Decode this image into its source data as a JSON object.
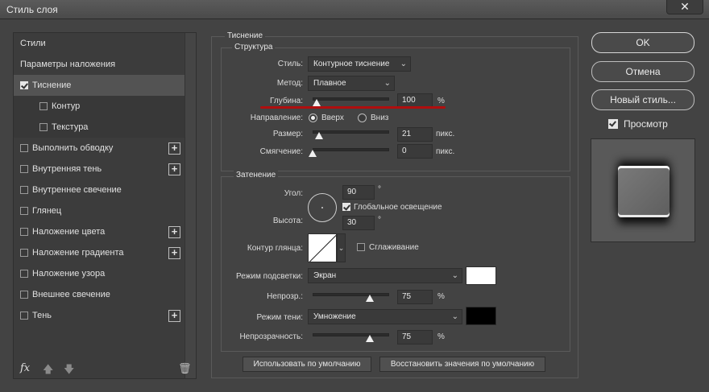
{
  "window": {
    "title": "Стиль слоя",
    "close": "✕"
  },
  "left": {
    "items": [
      {
        "label": "Стили",
        "checkbox": false,
        "plus": false,
        "sub": false,
        "selected": false
      },
      {
        "label": "Параметры наложения",
        "checkbox": false,
        "plus": false,
        "sub": false,
        "selected": false
      },
      {
        "label": "Тиснение",
        "checkbox": true,
        "checked": true,
        "plus": false,
        "sub": false,
        "selected": true
      },
      {
        "label": "Контур",
        "checkbox": true,
        "checked": false,
        "plus": false,
        "sub": true,
        "selected": false
      },
      {
        "label": "Текстура",
        "checkbox": true,
        "checked": false,
        "plus": false,
        "sub": true,
        "selected": false
      },
      {
        "label": "Выполнить обводку",
        "checkbox": true,
        "checked": false,
        "plus": true,
        "sub": false,
        "selected": false
      },
      {
        "label": "Внутренняя тень",
        "checkbox": true,
        "checked": false,
        "plus": true,
        "sub": false,
        "selected": false
      },
      {
        "label": "Внутреннее свечение",
        "checkbox": true,
        "checked": false,
        "plus": false,
        "sub": false,
        "selected": false
      },
      {
        "label": "Глянец",
        "checkbox": true,
        "checked": false,
        "plus": false,
        "sub": false,
        "selected": false
      },
      {
        "label": "Наложение цвета",
        "checkbox": true,
        "checked": false,
        "plus": true,
        "sub": false,
        "selected": false
      },
      {
        "label": "Наложение градиента",
        "checkbox": true,
        "checked": false,
        "plus": true,
        "sub": false,
        "selected": false
      },
      {
        "label": "Наложение узора",
        "checkbox": true,
        "checked": false,
        "plus": false,
        "sub": false,
        "selected": false
      },
      {
        "label": "Внешнее свечение",
        "checkbox": true,
        "checked": false,
        "plus": false,
        "sub": false,
        "selected": false
      },
      {
        "label": "Тень",
        "checkbox": true,
        "checked": false,
        "plus": true,
        "sub": false,
        "selected": false
      }
    ],
    "toolbar": {
      "fx": "fx",
      "up": "🡅",
      "down": "🡇",
      "trash": "🗑"
    }
  },
  "bevel": {
    "section_title": "Тиснение",
    "structure_title": "Структура",
    "style_label": "Стиль:",
    "style_value": "Контурное тиснение",
    "method_label": "Метод:",
    "method_value": "Плавное",
    "depth_label": "Глубина:",
    "depth_value": "100",
    "depth_unit": "%",
    "depth_level": 0.05,
    "direction_label": "Направление:",
    "direction_up": "Вверх",
    "direction_down": "Вниз",
    "size_label": "Размер:",
    "size_value": "21",
    "size_unit": "пикс.",
    "size_level": 0.08,
    "soften_label": "Смягчение:",
    "soften_value": "0",
    "soften_unit": "пикс.",
    "soften_level": 0.0
  },
  "shading": {
    "title": "Затенение",
    "angle_label": "Угол:",
    "angle_value": "90",
    "deg": "°",
    "global_light": "Глобальное освещение",
    "altitude_label": "Высота:",
    "altitude_value": "30",
    "gloss_label": "Контур глянца:",
    "antialias": "Сглаживание",
    "highlight_label": "Режим подсветки:",
    "highlight_mode": "Экран",
    "highlight_color": "#ffffff",
    "hl_opacity_label": "Непрозр.:",
    "hl_opacity_value": "75",
    "hl_opacity_level": 0.75,
    "shadow_label": "Режим тени:",
    "shadow_mode": "Умножение",
    "shadow_color": "#000000",
    "sh_opacity_label": "Непрозрачность:",
    "sh_opacity_value": "75",
    "sh_opacity_level": 0.75,
    "percent": "%"
  },
  "bottom": {
    "make_default": "Использовать по умолчанию",
    "reset_default": "Восстановить значения по умолчанию"
  },
  "right": {
    "ok": "OK",
    "cancel": "Отмена",
    "new_style": "Новый стиль...",
    "preview": "Просмотр",
    "preview_checked": true
  }
}
